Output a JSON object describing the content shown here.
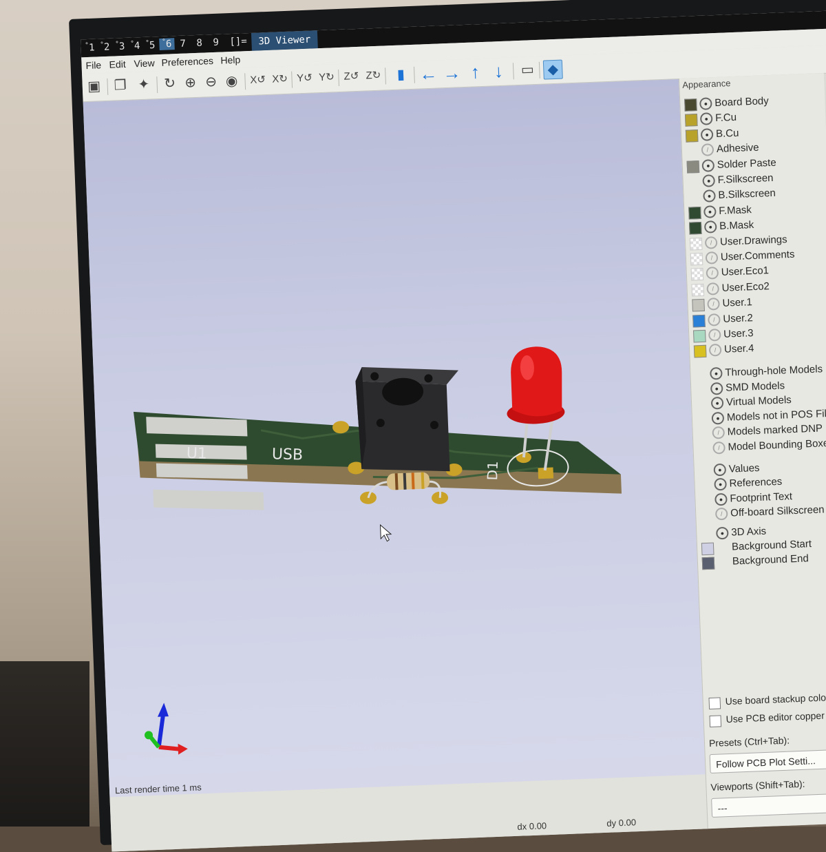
{
  "workspaces": {
    "items": [
      "1",
      "2",
      "3",
      "4",
      "5",
      "6",
      "7",
      "8",
      "9"
    ],
    "superscripts": [
      "°",
      "°",
      "°",
      "°",
      "°",
      "°"
    ],
    "layout": "[]=",
    "active": "6",
    "window_title": "3D Viewer"
  },
  "menu": {
    "file": "File",
    "edit": "Edit",
    "view": "View",
    "preferences": "Preferences",
    "help": "Help"
  },
  "toolbar": {
    "icons": [
      "export-icon",
      "copy-icon",
      "raytrace-icon",
      "reload-icon",
      "zoom-in-icon",
      "zoom-out-icon",
      "zoom-fit-icon",
      "rotate-x-cw-icon",
      "rotate-x-ccw-icon",
      "rotate-y-cw-icon",
      "rotate-y-ccw-icon",
      "rotate-z-cw-icon",
      "rotate-z-ccw-icon",
      "flip-board-icon",
      "move-left-icon",
      "move-right-icon",
      "move-up-icon",
      "move-down-icon",
      "ortho-icon",
      "appearance-icon"
    ]
  },
  "board": {
    "labels": {
      "u1": "U1",
      "usb": "USB",
      "d1": "D1"
    },
    "colors": {
      "solder_mask": "#2e4a2e",
      "silkscreen": "#e8e8e8",
      "copper": "#c9a227",
      "board_edge": "#7a6a4a",
      "led": "#e01818",
      "switch_body": "#2a2a2a"
    }
  },
  "canvas": {
    "render_time": "Last render time 1 ms",
    "background_top": "#b9bcd8",
    "background_bottom": "#d6d8ea"
  },
  "status": {
    "dx": "dx 0.00",
    "dy": "dy 0.00"
  },
  "appearance": {
    "title": "Appearance",
    "layers": [
      {
        "name": "Board Body",
        "color": "#4a4a30",
        "visible": true
      },
      {
        "name": "F.Cu",
        "color": "#b8a22a",
        "visible": true
      },
      {
        "name": "B.Cu",
        "color": "#b8a22a",
        "visible": true
      },
      {
        "name": "Adhesive",
        "color": "",
        "visible": false
      },
      {
        "name": "Solder Paste",
        "color": "#8a8a80",
        "visible": true
      },
      {
        "name": "F.Silkscreen",
        "color": "",
        "visible": true
      },
      {
        "name": "B.Silkscreen",
        "color": "",
        "visible": true
      },
      {
        "name": "F.Mask",
        "color": "#2f4a30",
        "visible": true
      },
      {
        "name": "B.Mask",
        "color": "#2f4a30",
        "visible": true
      },
      {
        "name": "User.Drawings",
        "color": "checker",
        "visible": false
      },
      {
        "name": "User.Comments",
        "color": "checker",
        "visible": false
      },
      {
        "name": "User.Eco1",
        "color": "checker",
        "visible": false
      },
      {
        "name": "User.Eco2",
        "color": "checker",
        "visible": false
      },
      {
        "name": "User.1",
        "color": "#c4c4bc",
        "visible": false
      },
      {
        "name": "User.2",
        "color": "#2a7fd6",
        "visible": false
      },
      {
        "name": "User.3",
        "color": "#a8d8c0",
        "visible": false
      },
      {
        "name": "User.4",
        "color": "#d8c020",
        "visible": false
      }
    ],
    "models": [
      {
        "name": "Through-hole Models",
        "visible": true
      },
      {
        "name": "SMD Models",
        "visible": true
      },
      {
        "name": "Virtual Models",
        "visible": true
      },
      {
        "name": "Models not in POS File",
        "visible": true
      },
      {
        "name": "Models marked DNP",
        "visible": false
      },
      {
        "name": "Model Bounding Boxes",
        "visible": false
      }
    ],
    "texts": [
      {
        "name": "Values",
        "visible": true
      },
      {
        "name": "References",
        "visible": true
      },
      {
        "name": "Footprint Text",
        "visible": true
      },
      {
        "name": "Off-board Silkscreen",
        "visible": false
      }
    ],
    "misc": [
      {
        "name": "3D Axis",
        "visible": true,
        "color": ""
      },
      {
        "name": "Background Start",
        "visible": null,
        "color": "#cfd0e4"
      },
      {
        "name": "Background End",
        "visible": null,
        "color": "#5a6070"
      }
    ],
    "use_board_stackup_colors": "Use board stackup colors",
    "use_pcb_copper_color": "Use PCB editor copper color",
    "presets_label": "Presets (Ctrl+Tab):",
    "presets_value": "Follow PCB Plot Setti...",
    "viewports_label": "Viewports (Shift+Tab):",
    "viewports_value": "---"
  }
}
